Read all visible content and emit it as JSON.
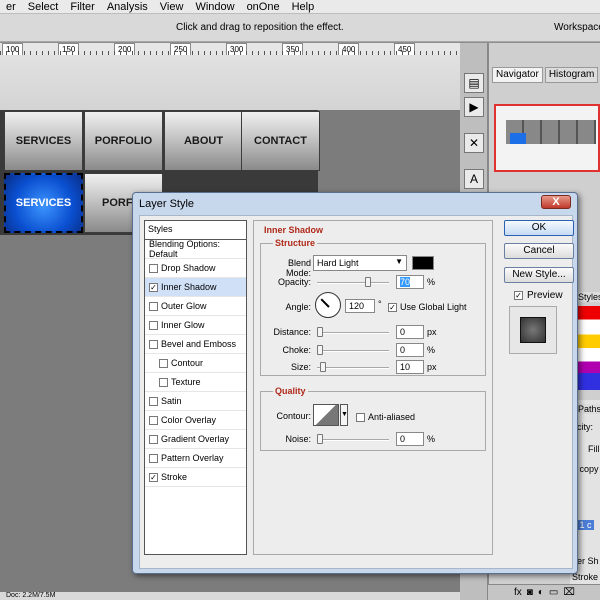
{
  "menu": {
    "items": [
      "er",
      "Select",
      "Filter",
      "Analysis",
      "View",
      "Window",
      "onOne",
      "Help"
    ],
    "workspace": "Workspace"
  },
  "options_bar": {
    "hint": "Click and drag to reposition the effect.",
    "workspace": "Workspace"
  },
  "ruler": {
    "labels": [
      "100",
      "150",
      "200",
      "250",
      "300",
      "350",
      "400",
      "450"
    ]
  },
  "canvas": {
    "nav_top": [
      "SERVICES",
      "PORFOLIO",
      "ABOUT",
      "CONTACT"
    ],
    "nav_bottom": [
      "SERVICES",
      "PORFO"
    ]
  },
  "right_panel": {
    "tabs": [
      "Navigator",
      "Histogram",
      "I"
    ],
    "styles_tab": "Styles",
    "paths_tab": "Paths",
    "layers_partial": [
      "acity:",
      "Fill:",
      "1 copy",
      "r 1 c",
      "ner Sh",
      "Stroke"
    ]
  },
  "dialog": {
    "title": "Layer Style",
    "close": "X",
    "list_header": "Styles",
    "list_items": [
      {
        "label": "Blending Options: Default",
        "checkbox": false,
        "checked": false,
        "indent": false,
        "selected": false
      },
      {
        "label": "Drop Shadow",
        "checkbox": true,
        "checked": false,
        "indent": false,
        "selected": false
      },
      {
        "label": "Inner Shadow",
        "checkbox": true,
        "checked": true,
        "indent": false,
        "selected": true
      },
      {
        "label": "Outer Glow",
        "checkbox": true,
        "checked": false,
        "indent": false,
        "selected": false
      },
      {
        "label": "Inner Glow",
        "checkbox": true,
        "checked": false,
        "indent": false,
        "selected": false
      },
      {
        "label": "Bevel and Emboss",
        "checkbox": true,
        "checked": false,
        "indent": false,
        "selected": false
      },
      {
        "label": "Contour",
        "checkbox": true,
        "checked": false,
        "indent": true,
        "selected": false
      },
      {
        "label": "Texture",
        "checkbox": true,
        "checked": false,
        "indent": true,
        "selected": false
      },
      {
        "label": "Satin",
        "checkbox": true,
        "checked": false,
        "indent": false,
        "selected": false
      },
      {
        "label": "Color Overlay",
        "checkbox": true,
        "checked": false,
        "indent": false,
        "selected": false
      },
      {
        "label": "Gradient Overlay",
        "checkbox": true,
        "checked": false,
        "indent": false,
        "selected": false
      },
      {
        "label": "Pattern Overlay",
        "checkbox": true,
        "checked": false,
        "indent": false,
        "selected": false
      },
      {
        "label": "Stroke",
        "checkbox": true,
        "checked": true,
        "indent": false,
        "selected": false
      }
    ],
    "panel_title": "Inner Shadow",
    "structure": {
      "title": "Structure",
      "blend_mode_label": "Blend Mode:",
      "blend_mode_value": "Hard Light",
      "blend_color": "#000000",
      "opacity_label": "Opacity:",
      "opacity_value": "70",
      "opacity_unit": "%",
      "angle_label": "Angle:",
      "angle_value": "120",
      "angle_unit": "°",
      "use_global_light": "Use Global Light",
      "use_global_light_checked": true,
      "distance_label": "Distance:",
      "distance_value": "0",
      "distance_unit": "px",
      "choke_label": "Choke:",
      "choke_value": "0",
      "choke_unit": "%",
      "size_label": "Size:",
      "size_value": "10",
      "size_unit": "px"
    },
    "quality": {
      "title": "Quality",
      "contour_label": "Contour:",
      "anti_aliased": "Anti-aliased",
      "anti_aliased_checked": false,
      "noise_label": "Noise:",
      "noise_value": "0",
      "noise_unit": "%"
    },
    "buttons": {
      "ok": "OK",
      "cancel": "Cancel",
      "new_style": "New Style...",
      "preview": "Preview",
      "preview_checked": true
    }
  },
  "status_bar": "Doc: 2.2M/7.5M",
  "colors": {
    "accent_blue": "#1d6fe8",
    "title_red": "#b02a1a"
  }
}
